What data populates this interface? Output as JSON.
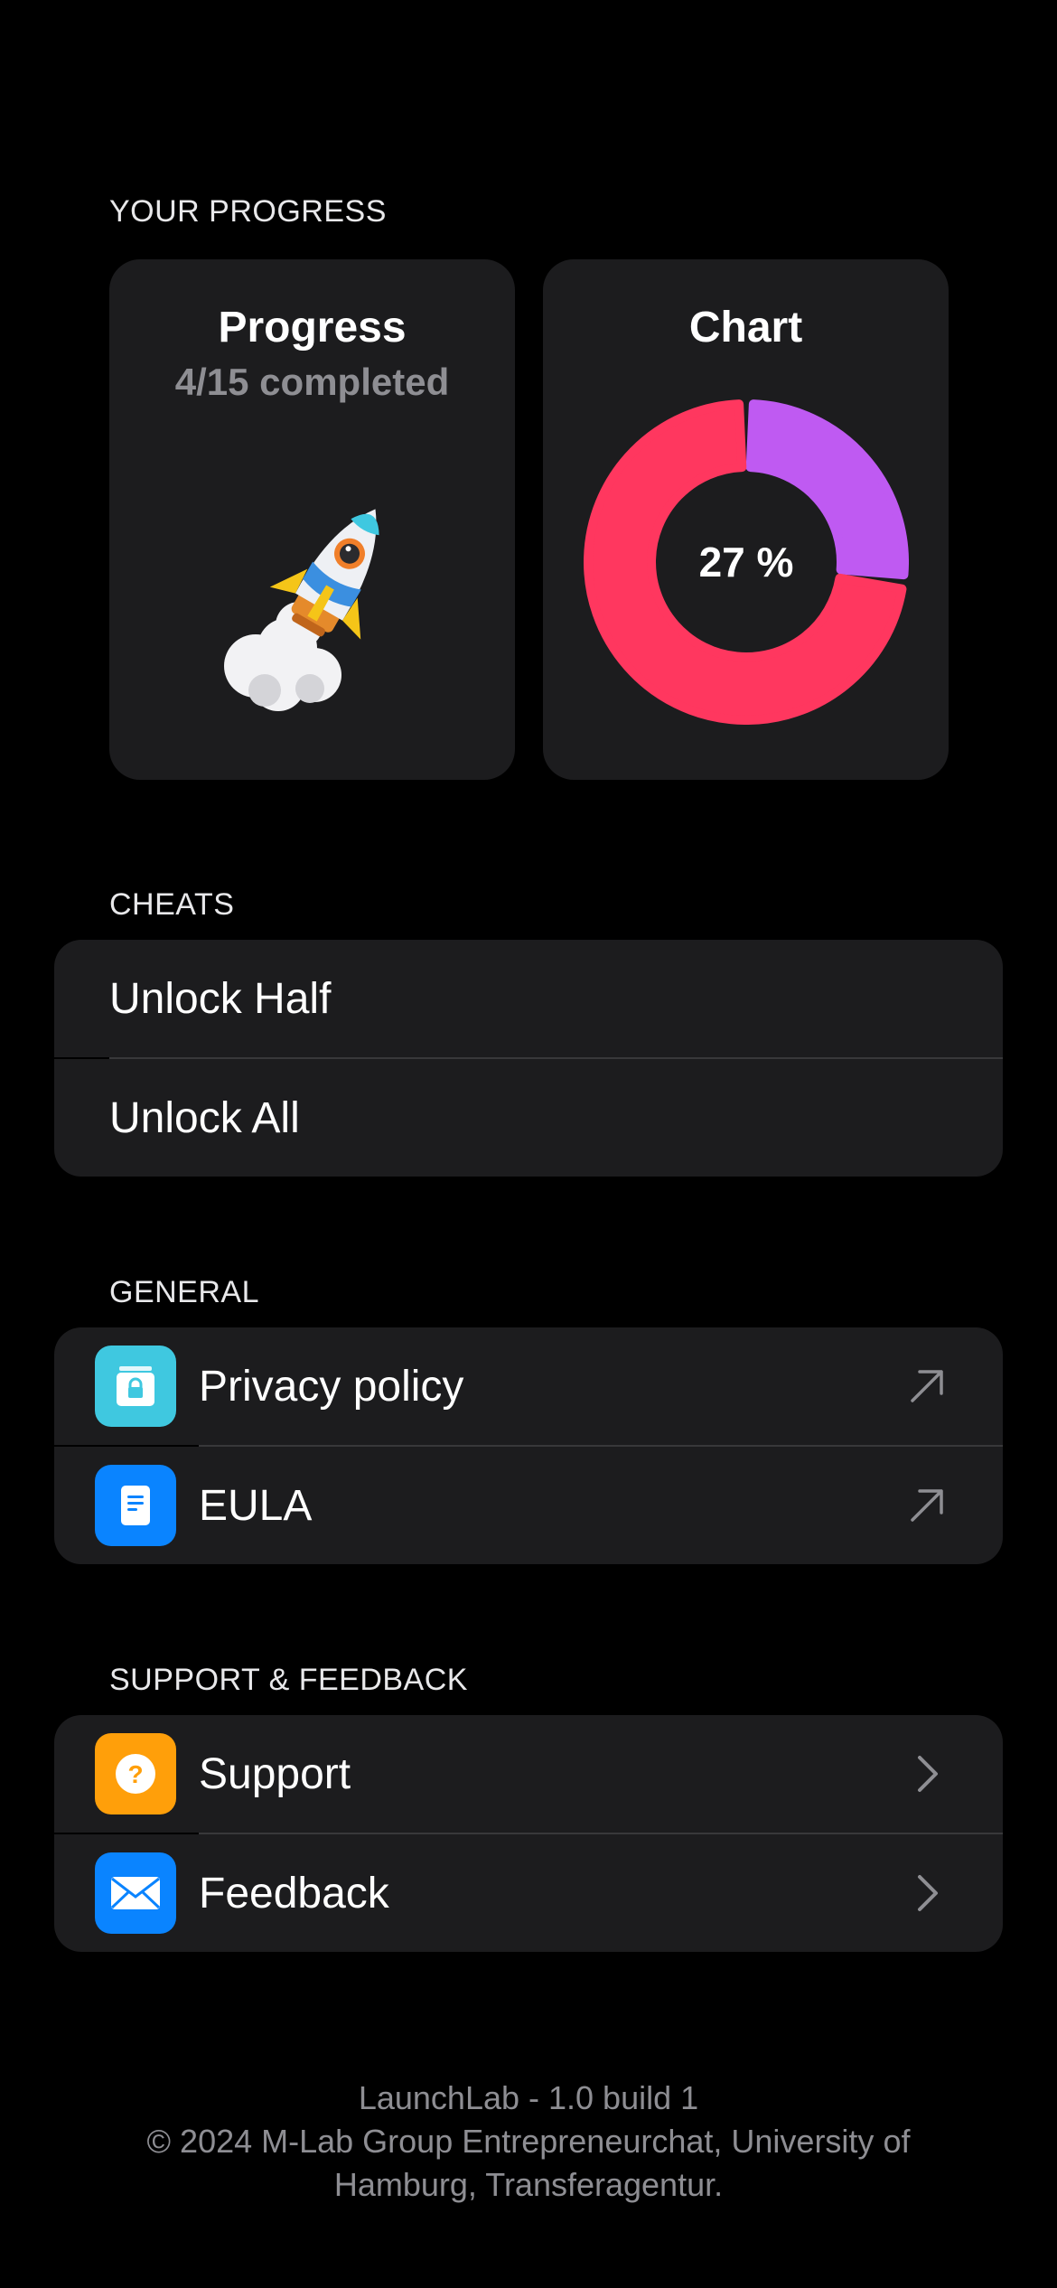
{
  "progress_section": {
    "header": "YOUR PROGRESS",
    "progress_card": {
      "title": "Progress",
      "subtitle": "4/15 completed"
    },
    "chart_card": {
      "title": "Chart",
      "percent_label": "27 %"
    }
  },
  "chart_data": {
    "type": "pie",
    "slices": [
      {
        "label": "completed",
        "value": 27,
        "color": "#bf5af2"
      },
      {
        "label": "remaining",
        "value": 73,
        "color": "#ff375f"
      }
    ],
    "center_label": "27 %"
  },
  "cheats": {
    "header": "CHEATS",
    "items": [
      {
        "label": "Unlock Half"
      },
      {
        "label": "Unlock All"
      }
    ]
  },
  "general": {
    "header": "GENERAL",
    "items": [
      {
        "label": "Privacy policy",
        "icon": "lock-icon",
        "icon_color": "#3fc8e0",
        "trailing": "arrow-up-right-icon"
      },
      {
        "label": "EULA",
        "icon": "document-icon",
        "icon_color": "#0a84ff",
        "trailing": "arrow-up-right-icon"
      }
    ]
  },
  "support": {
    "header": "SUPPORT & FEEDBACK",
    "items": [
      {
        "label": "Support",
        "icon": "question-icon",
        "icon_color": "#ff9f0a",
        "trailing": "chevron-right-icon"
      },
      {
        "label": "Feedback",
        "icon": "envelope-icon",
        "icon_color": "#0a84ff",
        "trailing": "chevron-right-icon"
      }
    ]
  },
  "footer": {
    "version": "LaunchLab - 1.0 build 1",
    "copyright_line1": "© 2024 M-Lab Group Entrepreneurchat, University of",
    "copyright_line2": "Hamburg, Transferagentur."
  }
}
